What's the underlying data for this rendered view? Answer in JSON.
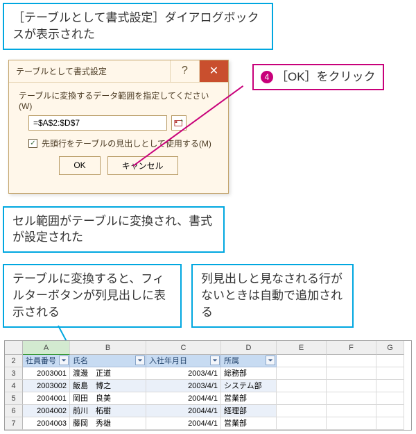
{
  "callout1": "［テーブルとして書式設定］ダイアログボックスが表示された",
  "dialog": {
    "title": "テーブルとして書式設定",
    "instruction": "テーブルに変換するデータ範囲を指定してください(W)",
    "range_value": "=$A$2:$D$7",
    "header_checkbox_label": "先頭行をテーブルの見出しとして使用する(M)",
    "header_checked": true,
    "ok": "OK",
    "cancel": "キャンセル"
  },
  "callout_step": {
    "num": "4",
    "text": "［OK］をクリック"
  },
  "callout2": "セル範囲がテーブルに変換され、書式が設定された",
  "callout3": "テーブルに変換すると、フィルターボタンが列見出しに表示される",
  "callout4": "列見出しと見なされる行がないときは自動で追加される",
  "excel": {
    "col_letters": [
      "A",
      "B",
      "C",
      "D",
      "E",
      "F",
      "G"
    ],
    "row_numbers": [
      "2",
      "3",
      "4",
      "5",
      "6",
      "7"
    ],
    "headers": [
      "社員番号",
      "氏名",
      "入社年月日",
      "所属"
    ],
    "rows": [
      {
        "id": "2003001",
        "name": "渡邊　正道",
        "date": "2003/4/1",
        "dept": "総務部"
      },
      {
        "id": "2003002",
        "name": "飯島　博之",
        "date": "2003/4/1",
        "dept": "システム部"
      },
      {
        "id": "2004001",
        "name": "岡田　良美",
        "date": "2004/4/1",
        "dept": "営業部"
      },
      {
        "id": "2004002",
        "name": "前川　柘樹",
        "date": "2004/4/1",
        "dept": "経理部"
      },
      {
        "id": "2004003",
        "name": "藤岡　秀雄",
        "date": "2004/4/1",
        "dept": "営業部"
      }
    ]
  }
}
